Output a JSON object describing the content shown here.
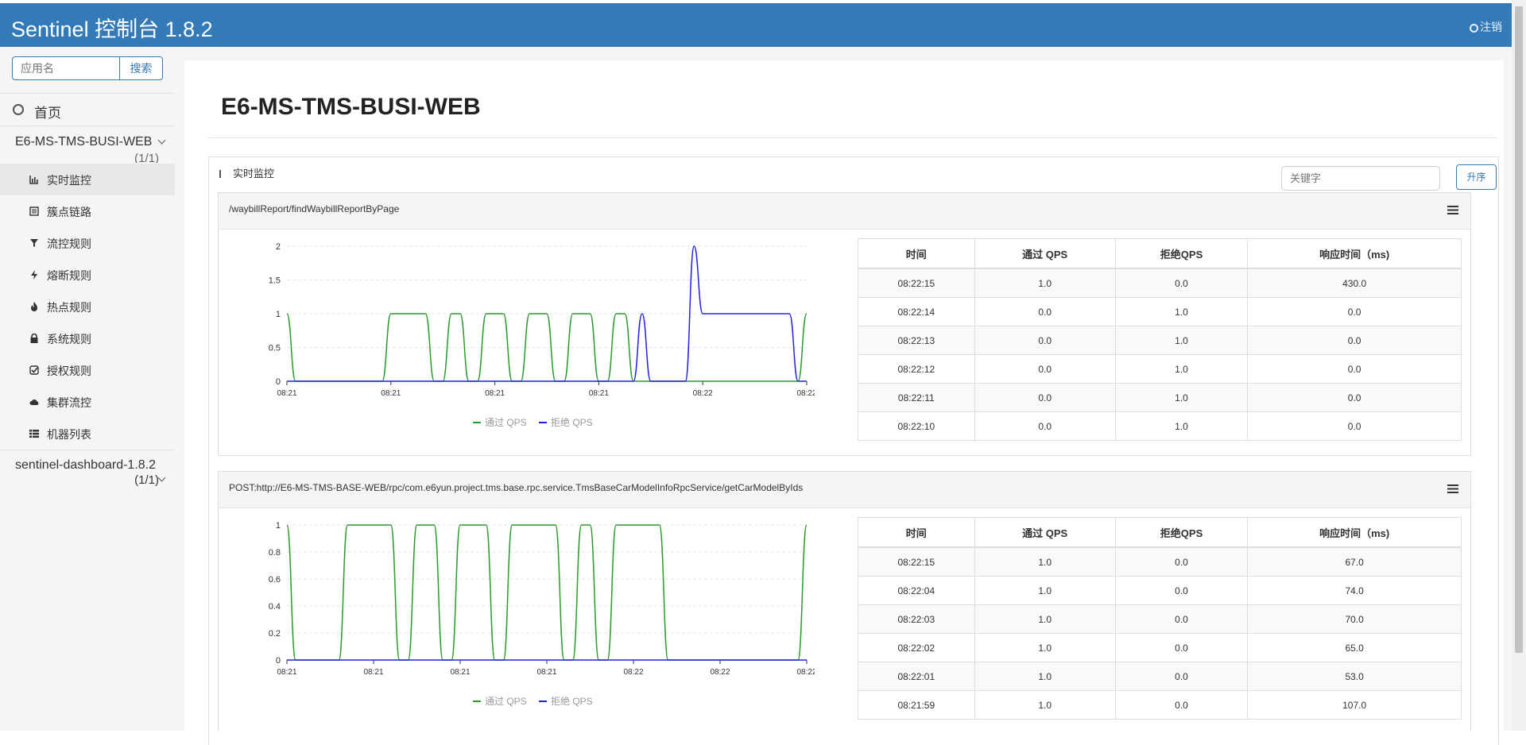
{
  "app": {
    "title": "Sentinel 控制台 1.8.2",
    "logout_label": "注销"
  },
  "sidebar": {
    "search_placeholder": "应用名",
    "search_button": "搜索",
    "home_label": "首页",
    "apps": [
      {
        "name": "E6-MS-TMS-BUSI-WEB",
        "count": "(1/1)"
      },
      {
        "name": "sentinel-dashboard-1.8.2",
        "count": "(1/1)"
      }
    ],
    "menu": [
      {
        "label": "实时监控",
        "icon": "bar-chart-icon"
      },
      {
        "label": "簇点链路",
        "icon": "list-icon"
      },
      {
        "label": "流控规则",
        "icon": "filter-icon"
      },
      {
        "label": "熔断规则",
        "icon": "flash-icon"
      },
      {
        "label": "热点规则",
        "icon": "fire-icon"
      },
      {
        "label": "系统规则",
        "icon": "lock-icon"
      },
      {
        "label": "授权规则",
        "icon": "check-square-icon"
      },
      {
        "label": "集群流控",
        "icon": "cloud-icon"
      },
      {
        "label": "机器列表",
        "icon": "th-list-icon"
      }
    ]
  },
  "main": {
    "page_title": "E6-MS-TMS-BUSI-WEB",
    "section_title": "实时监控",
    "keyword_placeholder": "关键字",
    "sort_button": "升序",
    "columns": [
      "时间",
      "通过 QPS",
      "拒绝QPS",
      "响应时间（ms)"
    ],
    "legend": [
      "通过 QPS",
      "拒绝 QPS"
    ],
    "colors": {
      "pass": "#2a9c2a",
      "block": "#2222dd",
      "header": "#337ab7"
    },
    "cards": [
      {
        "resource": "/waybillReport/findWaybillReportByPage",
        "rows": [
          [
            "08:22:15",
            "1.0",
            "0.0",
            "430.0"
          ],
          [
            "08:22:14",
            "0.0",
            "1.0",
            "0.0"
          ],
          [
            "08:22:13",
            "0.0",
            "1.0",
            "0.0"
          ],
          [
            "08:22:12",
            "0.0",
            "1.0",
            "0.0"
          ],
          [
            "08:22:11",
            "0.0",
            "1.0",
            "0.0"
          ],
          [
            "08:22:10",
            "0.0",
            "1.0",
            "0.0"
          ]
        ]
      },
      {
        "resource": "POST:http://E6-MS-TMS-BASE-WEB/rpc/com.e6yun.project.tms.base.rpc.service.TmsBaseCarModelInfoRpcService/getCarModelByIds",
        "rows": [
          [
            "08:22:15",
            "1.0",
            "0.0",
            "67.0"
          ],
          [
            "08:22:04",
            "1.0",
            "0.0",
            "74.0"
          ],
          [
            "08:22:03",
            "1.0",
            "0.0",
            "70.0"
          ],
          [
            "08:22:02",
            "1.0",
            "0.0",
            "65.0"
          ],
          [
            "08:22:01",
            "1.0",
            "0.0",
            "53.0"
          ],
          [
            "08:21:59",
            "1.0",
            "0.0",
            "107.0"
          ]
        ]
      }
    ]
  },
  "chart_data": [
    {
      "type": "line",
      "ylim": [
        0,
        2
      ],
      "yticks": [
        "0",
        "0.5",
        "1",
        "1.5",
        "2"
      ],
      "xticks": [
        "08:21",
        "08:21",
        "08:21",
        "08:21",
        "08:22",
        "08:22"
      ],
      "series": [
        {
          "name": "通过 QPS",
          "values": [
            1,
            0,
            0,
            0,
            0,
            0,
            0,
            0,
            0,
            0,
            0,
            0,
            1,
            1,
            1,
            1,
            1,
            0,
            0,
            1,
            1,
            0,
            0,
            1,
            1,
            1,
            0,
            0,
            1,
            1,
            1,
            0,
            0,
            1,
            1,
            1,
            0,
            0,
            1,
            1,
            0,
            0,
            0,
            0,
            0,
            0,
            0,
            0,
            0,
            0,
            0,
            0,
            0,
            0,
            0,
            0,
            0,
            0,
            0,
            0,
            1
          ]
        },
        {
          "name": "拒绝 QPS",
          "values": [
            0,
            0,
            0,
            0,
            0,
            0,
            0,
            0,
            0,
            0,
            0,
            0,
            0,
            0,
            0,
            0,
            0,
            0,
            0,
            0,
            0,
            0,
            0,
            0,
            0,
            0,
            0,
            0,
            0,
            0,
            0,
            0,
            0,
            0,
            0,
            0,
            0,
            0,
            0,
            0,
            0,
            1,
            0,
            0,
            0,
            0,
            0,
            2,
            1,
            1,
            1,
            1,
            1,
            1,
            1,
            1,
            1,
            1,
            1,
            0,
            0
          ]
        }
      ]
    },
    {
      "type": "line",
      "ylim": [
        0,
        1
      ],
      "yticks": [
        "0",
        "0.2",
        "0.4",
        "0.6",
        "0.8",
        "1"
      ],
      "xticks": [
        "08:21",
        "08:21",
        "08:21",
        "08:21",
        "08:22",
        "08:22",
        "08:22"
      ],
      "series": [
        {
          "name": "通过 QPS",
          "values": [
            1,
            0,
            0,
            0,
            0,
            0,
            0,
            1,
            1,
            1,
            1,
            1,
            1,
            0,
            0,
            1,
            1,
            1,
            0,
            0,
            1,
            1,
            1,
            1,
            0,
            0,
            1,
            1,
            1,
            1,
            1,
            1,
            0,
            0,
            1,
            1,
            0,
            0,
            1,
            1,
            1,
            1,
            1,
            1,
            0,
            0,
            0,
            0,
            0,
            0,
            0,
            0,
            0,
            0,
            0,
            0,
            0,
            0,
            0,
            0,
            1
          ]
        },
        {
          "name": "拒绝 QPS",
          "values": [
            0,
            0,
            0,
            0,
            0,
            0,
            0,
            0,
            0,
            0,
            0,
            0,
            0,
            0,
            0,
            0,
            0,
            0,
            0,
            0,
            0,
            0,
            0,
            0,
            0,
            0,
            0,
            0,
            0,
            0,
            0,
            0,
            0,
            0,
            0,
            0,
            0,
            0,
            0,
            0,
            0,
            0,
            0,
            0,
            0,
            0,
            0,
            0,
            0,
            0,
            0,
            0,
            0,
            0,
            0,
            0,
            0,
            0,
            0,
            0,
            0
          ]
        }
      ]
    }
  ]
}
